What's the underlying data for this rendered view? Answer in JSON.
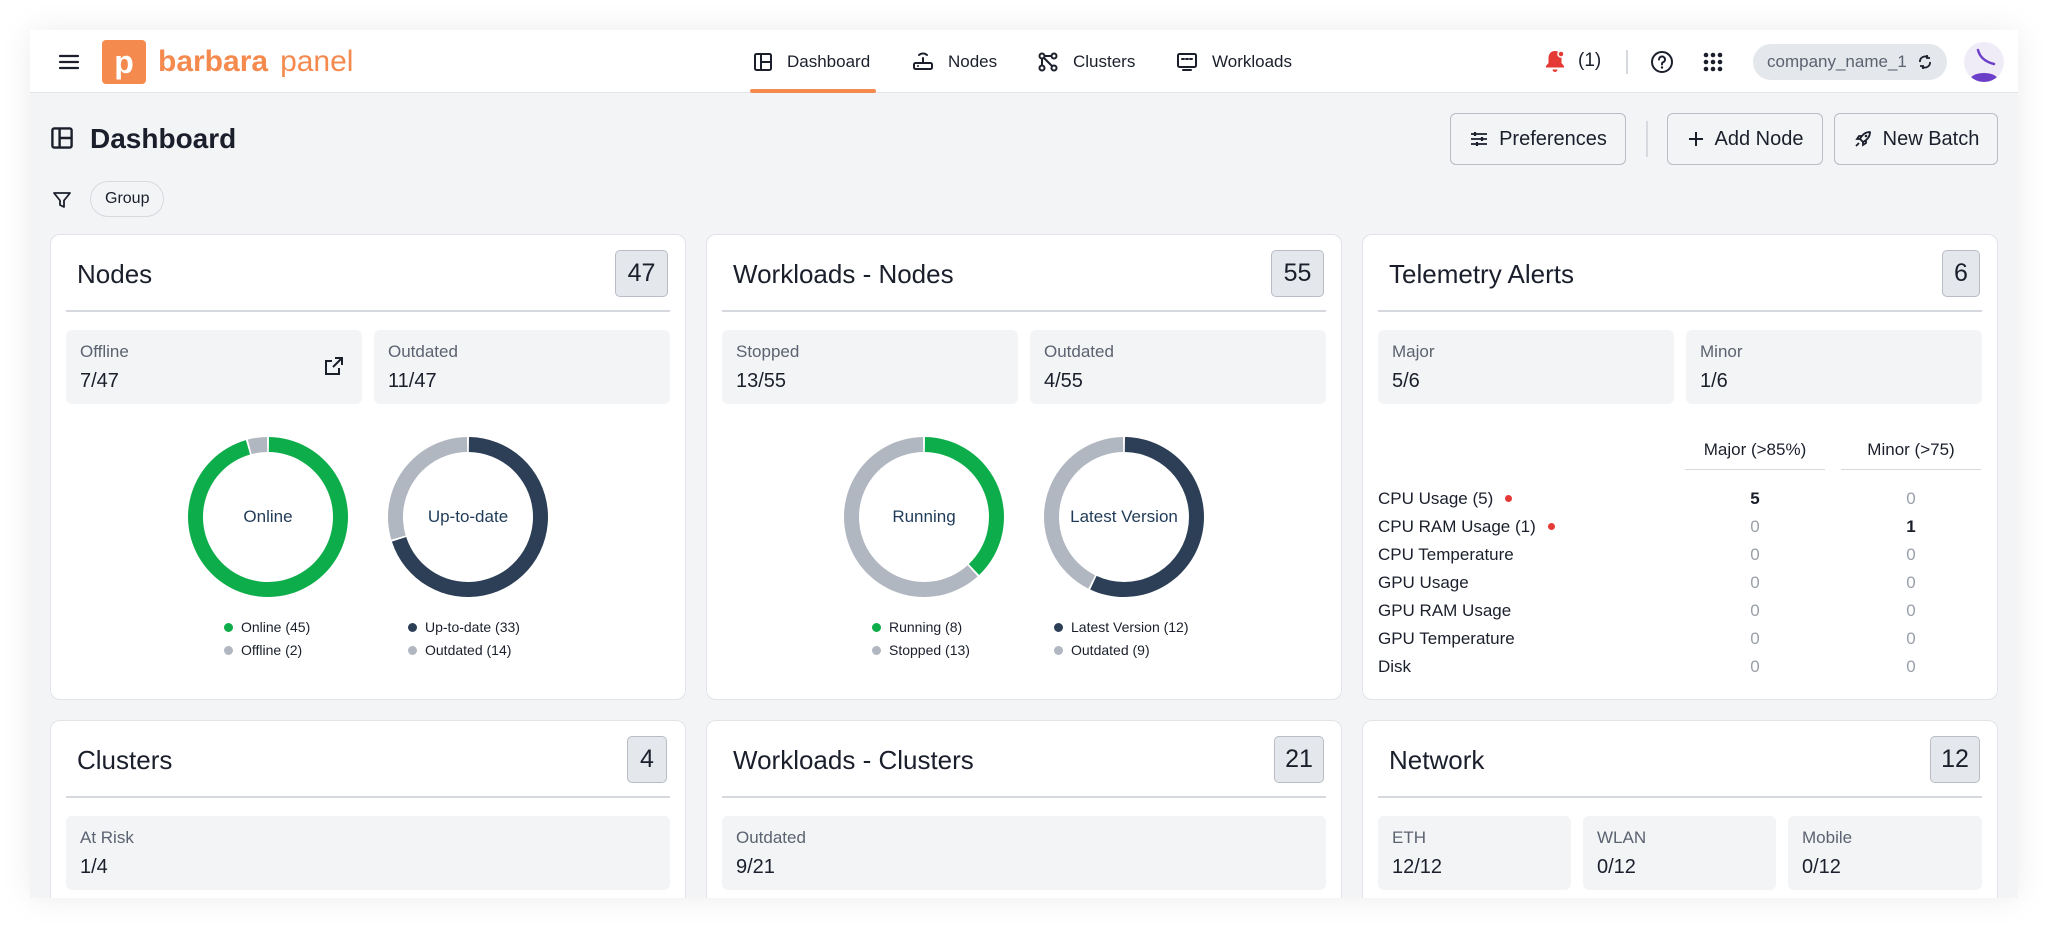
{
  "header": {
    "logo_letter": "p",
    "logo_brand": "barbara",
    "logo_product": "panel",
    "nav": [
      {
        "label": "Dashboard",
        "icon": "dashboard-icon",
        "active": true
      },
      {
        "label": "Nodes",
        "icon": "router-icon"
      },
      {
        "label": "Clusters",
        "icon": "cluster-icon"
      },
      {
        "label": "Workloads",
        "icon": "monitor-icon"
      }
    ],
    "notifications_count": "(1)",
    "company": "company_name_1"
  },
  "page": {
    "title": "Dashboard",
    "filter_chip": "Group",
    "buttons": {
      "preferences": "Preferences",
      "add_node": "Add Node",
      "new_batch": "New Batch"
    }
  },
  "colors": {
    "accent": "#f58a4f",
    "green": "#0ead4b",
    "navy": "#2c3f57",
    "grey": "#b0b7c0",
    "alert": "#e53935"
  },
  "cards": {
    "nodes": {
      "title": "Nodes",
      "count": "47",
      "stats": [
        {
          "label": "Offline",
          "value": "7/47"
        },
        {
          "label": "Outdated",
          "value": "11/47"
        }
      ],
      "donut1": {
        "label": "Online",
        "legend": [
          "Online (45)",
          "Offline (2)"
        ]
      },
      "donut2": {
        "label": "Up-to-date",
        "legend": [
          "Up-to-date (33)",
          "Outdated (14)"
        ]
      }
    },
    "workloads_nodes": {
      "title": "Workloads - Nodes",
      "count": "55",
      "stats": [
        {
          "label": "Stopped",
          "value": "13/55"
        },
        {
          "label": "Outdated",
          "value": "4/55"
        }
      ],
      "donut1": {
        "label": "Running",
        "legend": [
          "Running (8)",
          "Stopped (13)"
        ]
      },
      "donut2": {
        "label": "Latest Version",
        "legend": [
          "Latest Version (12)",
          "Outdated (9)"
        ]
      }
    },
    "telemetry": {
      "title": "Telemetry Alerts",
      "count": "6",
      "stats": [
        {
          "label": "Major",
          "value": "5/6"
        },
        {
          "label": "Minor",
          "value": "1/6"
        }
      ],
      "columns": [
        "Major (>85%)",
        "Minor (>75)"
      ],
      "rows": [
        {
          "name": "CPU Usage (5)",
          "major": "5",
          "minor": "0",
          "alert": true
        },
        {
          "name": "CPU RAM Usage (1)",
          "major": "0",
          "minor": "1",
          "alert": true
        },
        {
          "name": "CPU Temperature",
          "major": "0",
          "minor": "0"
        },
        {
          "name": "GPU Usage",
          "major": "0",
          "minor": "0"
        },
        {
          "name": "GPU RAM Usage",
          "major": "0",
          "minor": "0"
        },
        {
          "name": "GPU Temperature",
          "major": "0",
          "minor": "0"
        },
        {
          "name": "Disk",
          "major": "0",
          "minor": "0"
        }
      ]
    },
    "clusters": {
      "title": "Clusters",
      "count": "4",
      "stats": [
        {
          "label": "At Risk",
          "value": "1/4"
        }
      ]
    },
    "workloads_clusters": {
      "title": "Workloads - Clusters",
      "count": "21",
      "stats": [
        {
          "label": "Outdated",
          "value": "9/21"
        }
      ]
    },
    "network": {
      "title": "Network",
      "count": "12",
      "stats": [
        {
          "label": "ETH",
          "value": "12/12"
        },
        {
          "label": "WLAN",
          "value": "0/12"
        },
        {
          "label": "Mobile",
          "value": "0/12"
        }
      ]
    }
  },
  "chart_data": [
    {
      "type": "pie",
      "categories": [
        "Online",
        "Offline"
      ],
      "values": [
        45,
        2
      ]
    },
    {
      "type": "pie",
      "categories": [
        "Up-to-date",
        "Outdated"
      ],
      "values": [
        33,
        14
      ]
    },
    {
      "type": "pie",
      "categories": [
        "Running",
        "Stopped"
      ],
      "values": [
        8,
        13
      ]
    },
    {
      "type": "pie",
      "categories": [
        "Latest Version",
        "Outdated"
      ],
      "values": [
        12,
        9
      ]
    }
  ]
}
